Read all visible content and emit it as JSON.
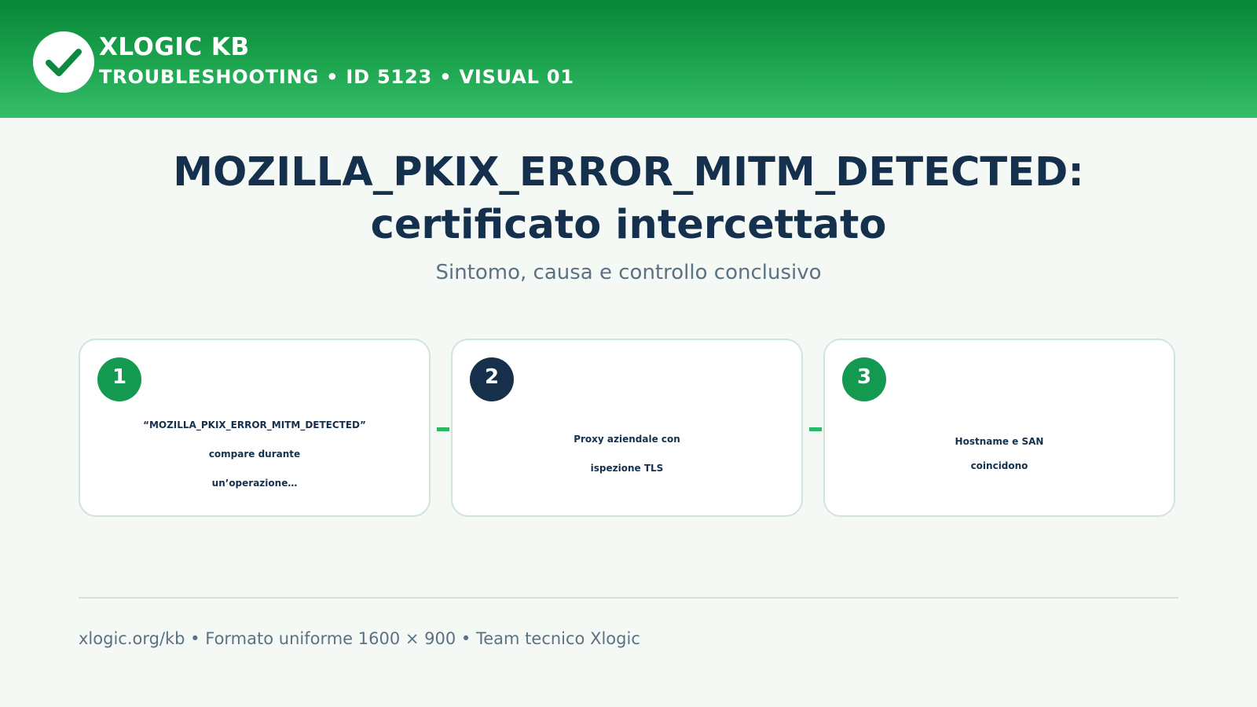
{
  "header": {
    "logo_icon": "checkmark-icon",
    "brand_name": "XLOGIC KB",
    "meta": "TROUBLESHOOTING • ID 5123 • VISUAL 01"
  },
  "title": {
    "line1": "MOZILLA_PKIX_ERROR_MITM_DETECTED:",
    "line2": "certificato intercettato"
  },
  "subtitle": "Sintomo, causa e controllo conclusivo",
  "steps": [
    {
      "number": "1",
      "lines": [
        "“MOZILLA_PKIX_ERROR_MITM_DETECTED”",
        "compare durante",
        "un’operazione…"
      ]
    },
    {
      "number": "2",
      "lines": [
        "Proxy aziendale con",
        "ispezione TLS"
      ]
    },
    {
      "number": "3",
      "lines": [
        "Hostname e SAN",
        "coincidono"
      ]
    }
  ],
  "footer": "xlogic.org/kb • Formato uniforme 1600 × 900 • Team tecnico Xlogic",
  "colors": {
    "header_green": "#078538",
    "accent_green": "#139a50",
    "navy": "#15304d",
    "muted": "#5c7182"
  }
}
